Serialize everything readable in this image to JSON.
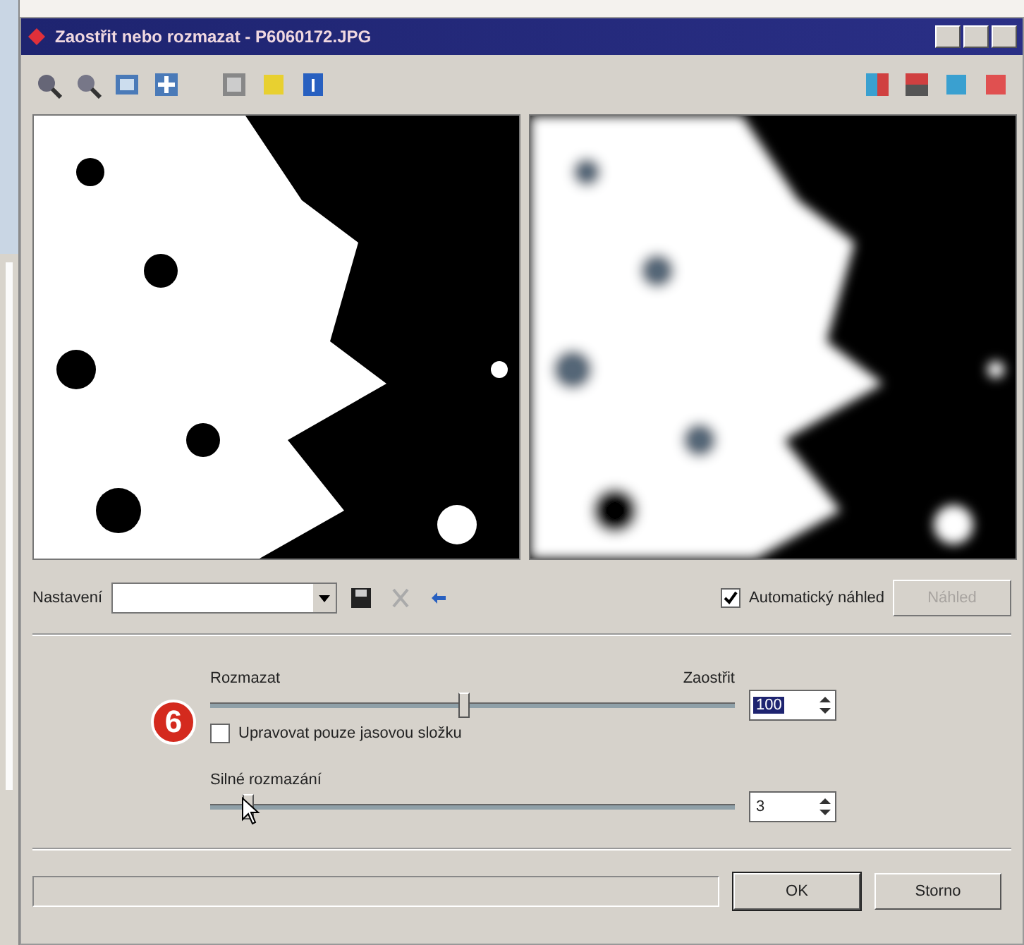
{
  "window": {
    "title": "Zaostřit nebo rozmazat - P6060172.JPG"
  },
  "preset": {
    "label": "Nastavení"
  },
  "auto_preview": {
    "label": "Automatický náhled",
    "checked": true
  },
  "preview_button": {
    "label": "Náhled",
    "disabled": true
  },
  "sharpen": {
    "left_label": "Rozmazat",
    "right_label": "Zaostřit",
    "level": 0.48,
    "value": "100",
    "selected_text": true
  },
  "luminance_only": {
    "label": "Upravovat pouze jasovou složku",
    "checked": false
  },
  "blur_strength": {
    "label": "Silné rozmazání",
    "level": 0.07,
    "value": "3",
    "selected_text": false
  },
  "buttons": [
    {
      "label": "OK",
      "default": true
    },
    {
      "label": "Storno",
      "default": false
    }
  ],
  "progress": {
    "level": 0
  },
  "callout": "6"
}
